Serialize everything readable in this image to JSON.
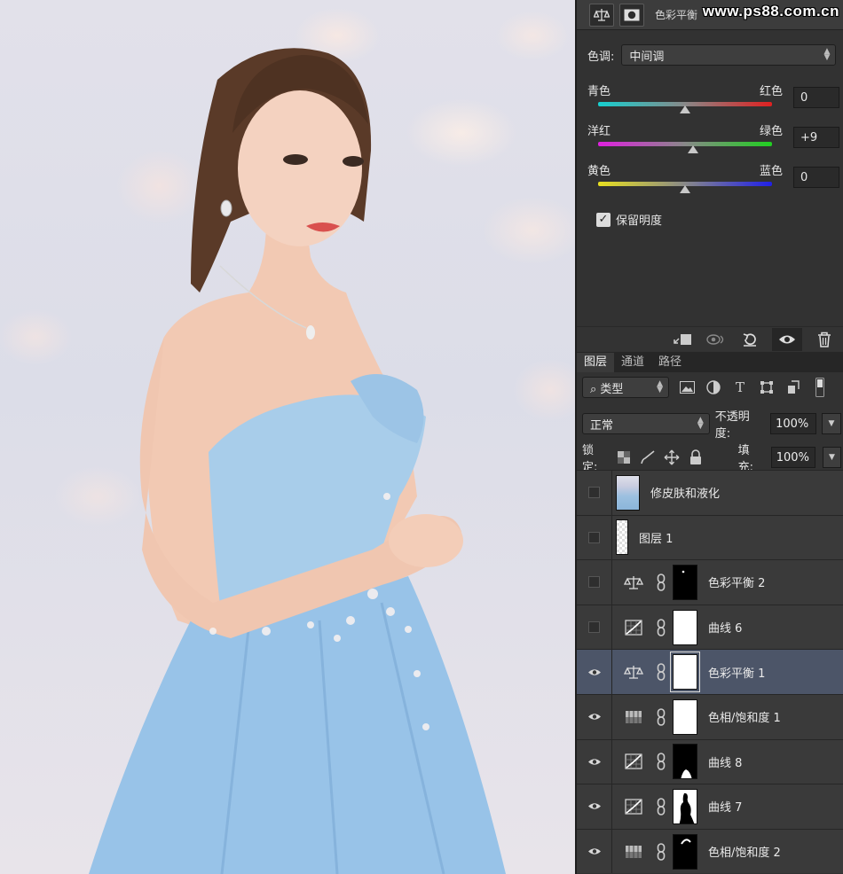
{
  "watermark": "www.ps88.com.cn",
  "properties": {
    "title": "色彩平衡",
    "tone_label": "色调:",
    "tone_value": "中间调",
    "sliders": [
      {
        "left": "青色",
        "right": "红色",
        "value": "0",
        "level": 0,
        "gradient": "linear-gradient(90deg,#16d0d0,#888,#e02020)"
      },
      {
        "left": "洋红",
        "right": "绿色",
        "value": "+9",
        "level": 9,
        "gradient": "linear-gradient(90deg,#e020e0,#888,#20d020)"
      },
      {
        "left": "黄色",
        "right": "蓝色",
        "value": "0",
        "level": 0,
        "gradient": "linear-gradient(90deg,#e8e020,#888,#2020e8)"
      }
    ],
    "preserve_luminosity_label": "保留明度",
    "preserve_luminosity_checked": true
  },
  "layers_panel": {
    "tabs": [
      {
        "label": "图层",
        "active": true
      },
      {
        "label": "通道",
        "active": false
      },
      {
        "label": "路径",
        "active": false
      }
    ],
    "filter_label": "类型",
    "blend_mode": "正常",
    "opacity_label": "不透明度:",
    "opacity_value": "100%",
    "lock_label": "锁定:",
    "fill_label": "填充:",
    "fill_value": "100%",
    "layers": [
      {
        "name": "修皮肤和液化",
        "kind": "photo",
        "visible": false,
        "selected": false
      },
      {
        "name": "图层 1",
        "kind": "empty",
        "visible": false,
        "selected": false
      },
      {
        "name": "色彩平衡 2",
        "kind": "balance",
        "visible": false,
        "selected": false,
        "mask": "black-dot"
      },
      {
        "name": "曲线 6",
        "kind": "curves",
        "visible": false,
        "selected": false,
        "mask": "white"
      },
      {
        "name": "色彩平衡 1",
        "kind": "balance",
        "visible": true,
        "selected": true,
        "mask": "white"
      },
      {
        "name": "色相/饱和度 1",
        "kind": "hue",
        "visible": true,
        "selected": false,
        "mask": "white"
      },
      {
        "name": "曲线 8",
        "kind": "curves",
        "visible": true,
        "selected": false,
        "mask": "black-dress"
      },
      {
        "name": "曲线 7",
        "kind": "curves",
        "visible": true,
        "selected": false,
        "mask": "white-silhouette"
      },
      {
        "name": "色相/饱和度 2",
        "kind": "hue",
        "visible": true,
        "selected": false,
        "mask": "black-arc"
      }
    ]
  }
}
